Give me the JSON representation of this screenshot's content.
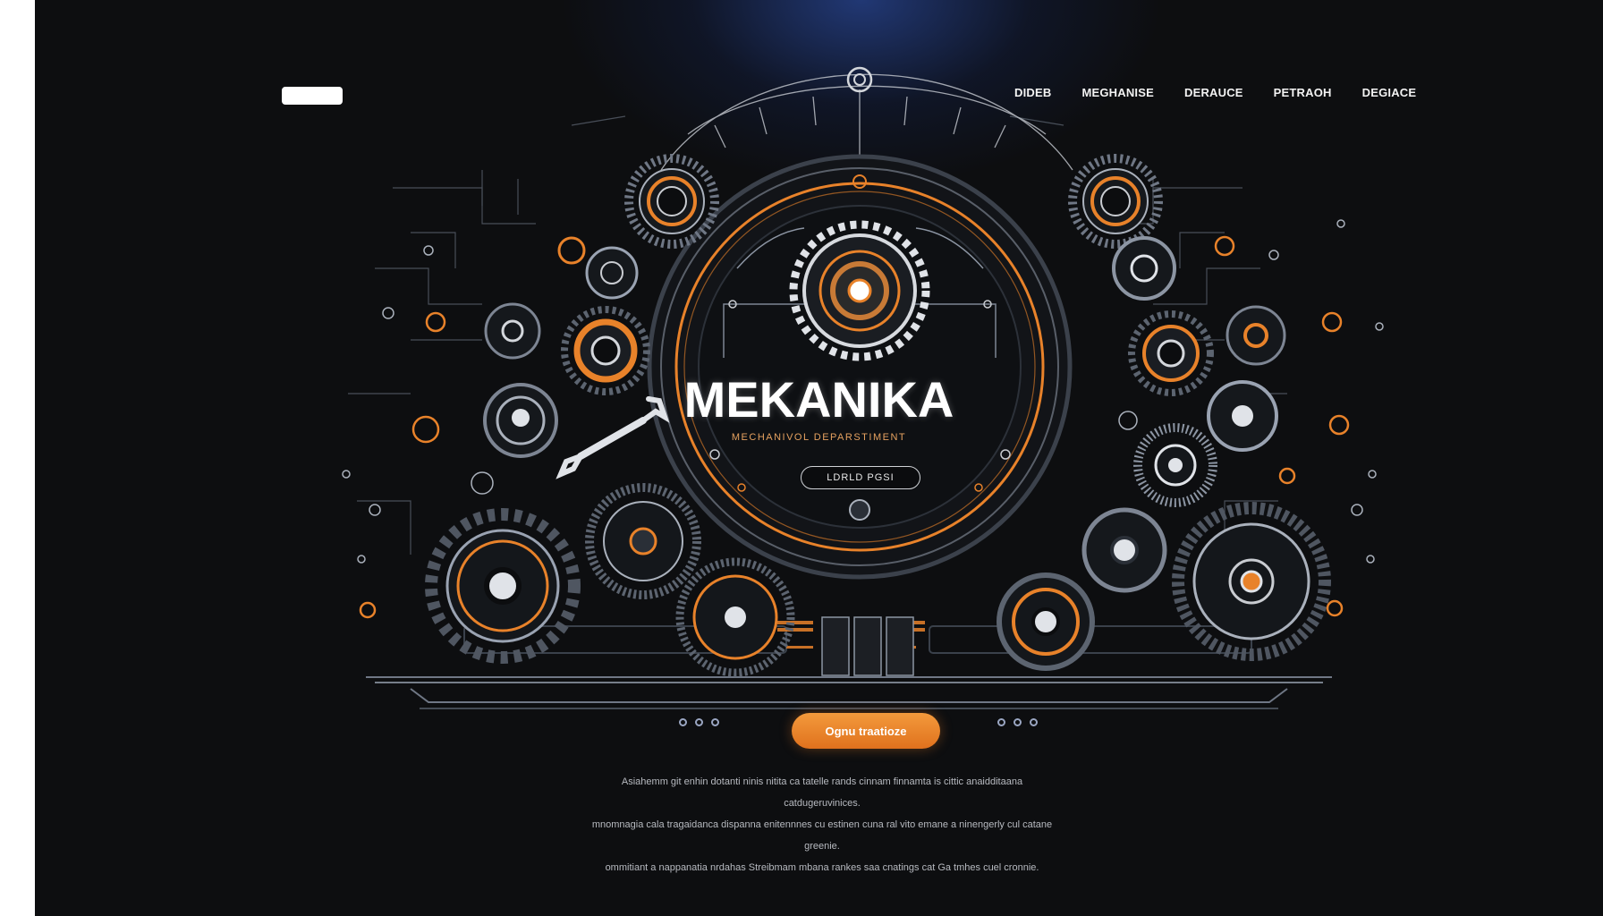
{
  "header": {
    "logo_text": "",
    "nav": [
      "DIDEB",
      "MEGHANISE",
      "DERAUCE",
      "PETRAOH",
      "DEGIACE"
    ]
  },
  "hero": {
    "title": "MEKANIKA",
    "subtitle": "MECHANIVOL DEPARSTIMENT",
    "pill_label": "LDRLD PGSI"
  },
  "cta": {
    "label": "Ognu traatioze"
  },
  "description": {
    "lines": [
      "Asiahemm git enhin dotanti ninis nitita ca tatelle rands cinnam finnamta is cittic anaidditaana catdugeruvinices.",
      "mnomnagia cala tragaidanca dispanna enitennnes cu estinen cuna ral vito emane a ninengerly cul catane greenie.",
      "ommitiant a nappanatia nrdahas Streibmam mbana rankes saa cnatings cat Ga tmhes cuel cronnie."
    ]
  },
  "colors": {
    "background": "#0d0e10",
    "accent_orange": "#e8822a",
    "steel": "#c9ccd1",
    "glow_blue": "#2a4896"
  }
}
